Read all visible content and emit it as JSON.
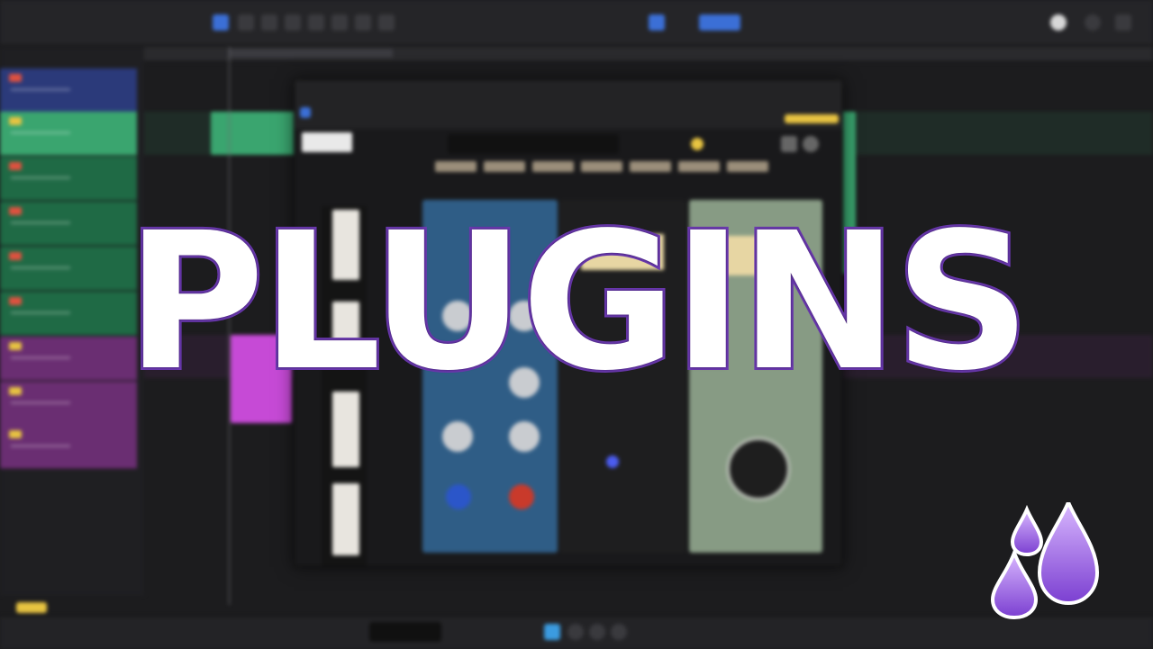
{
  "app": {
    "window_title": ""
  },
  "headline": {
    "text": "PLUGINS"
  },
  "brand": {
    "logo": "purple-droplets-logo",
    "accent": "#7b3fd1",
    "stroke": "#6b39b0"
  },
  "tracks": [
    {
      "color": "#2b3a7a"
    },
    {
      "color": "#3aa56f"
    },
    {
      "color": "#1f6a45"
    },
    {
      "color": "#1f6a45"
    },
    {
      "color": "#1f6a45"
    },
    {
      "color": "#1f6a45"
    },
    {
      "color": "#6a2e72"
    },
    {
      "color": "#6a2e72"
    },
    {
      "color": "#6a2e72"
    }
  ],
  "plugin": {
    "panels": [
      {
        "name": "blue-eq-module",
        "color": "#2f5d86"
      },
      {
        "name": "dark-comp-module",
        "color": "#1e1e1f"
      },
      {
        "name": "green-comp-module",
        "color": "#879b84"
      }
    ]
  }
}
